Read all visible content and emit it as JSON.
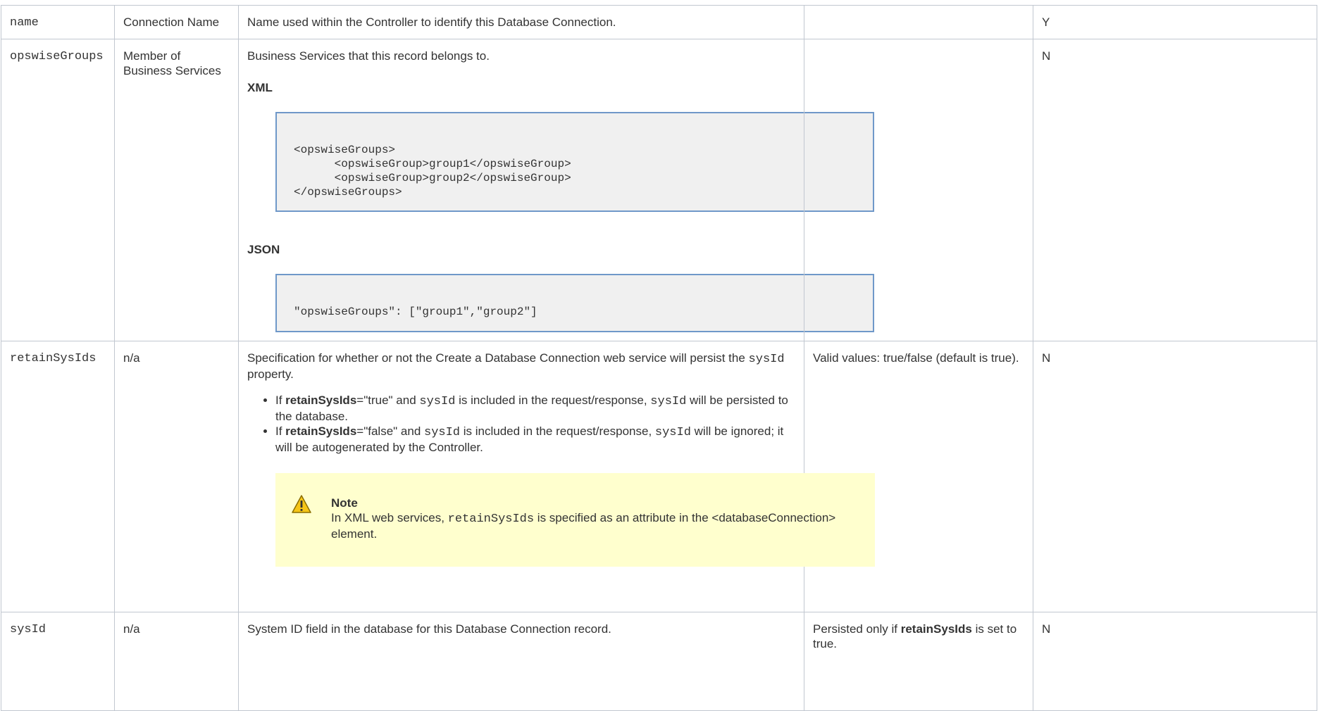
{
  "rows": [
    {
      "name": "name",
      "label": "Connection Name",
      "description": "Name used within the Controller to identify this Database Connection.",
      "values": "",
      "required": "Y"
    },
    {
      "name": "opswiseGroups",
      "label": "Member of Business Services",
      "description": "Business Services that this record belongs to.",
      "xml_title": "XML",
      "xml_code": "<opswiseGroups>\n      <opswiseGroup>group1</opswiseGroup>\n      <opswiseGroup>group2</opswiseGroup>\n</opswiseGroups>",
      "json_title": "JSON",
      "json_code": "\"opswiseGroups\": [\"group1\",\"group2\"]",
      "values": "",
      "required": "N"
    },
    {
      "name": "retainSysIds",
      "label": "n/a",
      "description_part1": "Specification for whether or not the Create a Database Connection web service will persist the ",
      "description_code": "sysId",
      "description_part2": " property.",
      "bullet1": {
        "prefix": "If ",
        "bold": "retainSysIds",
        "mid": "=\"true\" and ",
        "code1": "sysId",
        "mid2": " is included in the request/response, ",
        "code2": "sysId",
        "suffix": " will be persisted to the database."
      },
      "bullet2": {
        "prefix": "If ",
        "bold": "retainSysIds",
        "mid": "=\"false\" and ",
        "code1": "sysId",
        "mid2": " is included in the request/response, ",
        "code2": "sysId",
        "suffix": " will be ignored; it will be autogenerated by the Controller."
      },
      "note": {
        "icon": "warning-icon",
        "title": "Note",
        "body_prefix": "In XML web services, ",
        "body_code": "retainSysIds",
        "body_suffix": " is specified as an attribute in the <databaseConnection> element."
      },
      "values": "Valid values: true/false (default is true).",
      "required": "N"
    },
    {
      "name": "sysId",
      "label": "n/a",
      "description": "System ID field in the database for this Database Connection record.",
      "values_prefix": "Persisted only if ",
      "values_bold": "retainSysIds",
      "values_suffix": " is set to true.",
      "required": "N"
    }
  ],
  "colors": {
    "border": "#c1c7d0",
    "code_background": "#f0f0f0",
    "code_border": "#6f98c9",
    "note_background": "#ffffce",
    "warning_icon": "#f5c518"
  }
}
